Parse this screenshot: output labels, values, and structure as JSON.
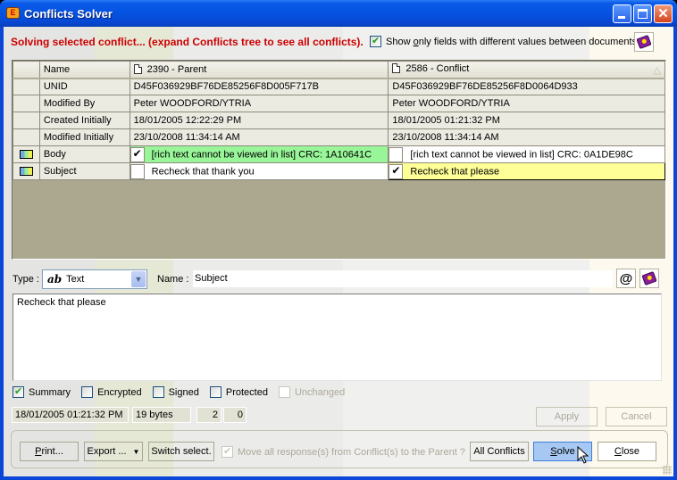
{
  "window": {
    "title": "Conflicts Solver",
    "app_icon": "conflicts-solver-icon",
    "controls": [
      "minimize",
      "maximize",
      "close"
    ]
  },
  "header": {
    "status_message": "Solving selected conflict... (expand Conflicts tree to see all conflicts).",
    "show_only_label_pre": "Show ",
    "show_only_label_u": "o",
    "show_only_label_post": "nly fields with different values between documents",
    "show_only_checked": true,
    "help_icon": "book-help-icon"
  },
  "grid": {
    "columns": {
      "name": "Name",
      "parent": "2390 - Parent",
      "conflict": "2586 - Conflict",
      "sort_indicator": "△"
    },
    "rows": [
      {
        "label": "UNID",
        "parent": "D45F036929BF76DE85256F8D005F717B",
        "conflict": "D45F036929BF76DE85256F8D0064D933"
      },
      {
        "label": "Modified By",
        "parent": "Peter WOODFORD/YTRIA",
        "conflict": "Peter WOODFORD/YTRIA"
      },
      {
        "label": "Created Initially",
        "parent": "18/01/2005 12:22:29 PM",
        "conflict": "18/01/2005 01:21:32 PM"
      },
      {
        "label": "Modified Initially",
        "parent": "23/10/2008 11:34:14 AM",
        "conflict": "23/10/2008 11:34:14 AM"
      },
      {
        "label": "Body",
        "parent": "[rich text cannot be viewed in list] CRC: 1A10641C",
        "conflict": "[rich text cannot be viewed in list] CRC: 0A1DE98C",
        "parent_checked": true,
        "conflict_checked": false,
        "field_icon": "field-icon"
      },
      {
        "label": "Subject",
        "parent": "Recheck that thank you",
        "conflict": "Recheck that please",
        "parent_checked": false,
        "conflict_checked": true,
        "field_icon": "field-icon"
      }
    ],
    "colors": {
      "selected_green": "#98f598",
      "selected_yellow": "#ffff98"
    }
  },
  "editor": {
    "type_label": "Type :",
    "type_value": "Text",
    "type_glyph": "ab",
    "name_label": "Name :",
    "name_value": "Subject",
    "value_text": "Recheck that please"
  },
  "flags": [
    {
      "label": "Summary",
      "checked": true,
      "disabled": false
    },
    {
      "label": "Encrypted",
      "checked": false,
      "disabled": false
    },
    {
      "label": "Signed",
      "checked": false,
      "disabled": false
    },
    {
      "label": "Protected",
      "checked": false,
      "disabled": false
    },
    {
      "label": "Unchanged",
      "checked": false,
      "disabled": true
    }
  ],
  "info": {
    "timestamp": "18/01/2005 01:21:32 PM",
    "size": "19 bytes",
    "count1": "2",
    "count2": "0"
  },
  "actions": {
    "apply": "Apply",
    "cancel": "Cancel"
  },
  "footer": {
    "print_u": "P",
    "print_rest": "rint...",
    "export": "Export ...",
    "switch_select": "Switch select.",
    "move_all": "Move all response(s) from Conflict(s) to the Parent ?",
    "move_all_checked": true,
    "all_conflicts": "All Conflicts",
    "solve_u": "S",
    "solve_rest": "olve",
    "close_u": "C",
    "close_rest": "lose"
  }
}
